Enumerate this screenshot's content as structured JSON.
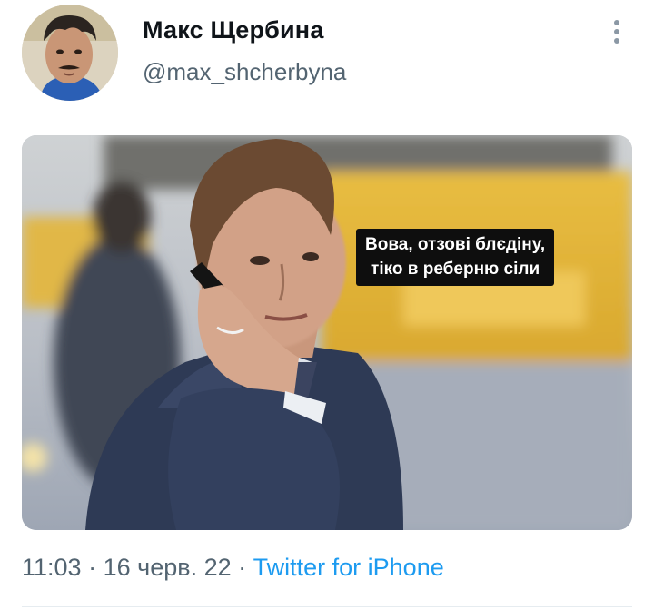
{
  "tweet": {
    "author": {
      "display_name": "Макс Щербина",
      "handle": "@max_shcherbyna",
      "avatar_icon": "user-avatar-photo"
    },
    "more_icon": "more-vertical-icon",
    "media": {
      "caption_lines": [
        "Вова, отзові блєдіну,",
        "тіко в реберню сіли"
      ]
    },
    "meta": {
      "time": "11:03",
      "separator": "·",
      "date": "16 черв. 22",
      "source": "Twitter for iPhone"
    }
  },
  "colors": {
    "secondary_text": "#536471",
    "link": "#1d9bf0",
    "caption_bg": "#0e0e0e"
  }
}
